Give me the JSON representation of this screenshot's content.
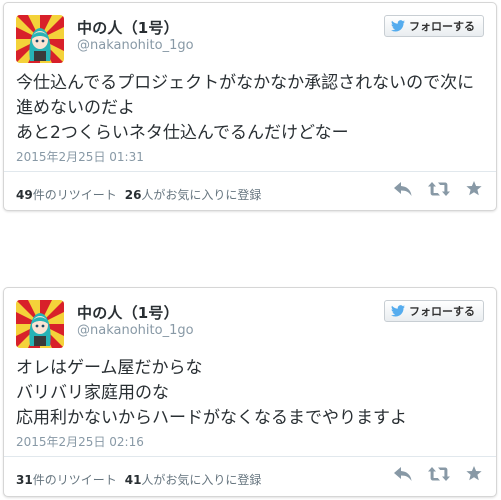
{
  "tweets": [
    {
      "name": "中の人（1号）",
      "handle": "@nakanohito_1go",
      "follow_label": "フォローする",
      "text": "今仕込んでるプロジェクトがなかなか承認されないので次に\n進めないのだよ\nあと2つくらいネタ仕込んでるんだけどなー",
      "timestamp": "2015年2月25日  01:31",
      "retweet_count": "49",
      "retweet_suffix": "件のリツイート",
      "favorite_count": "26",
      "favorite_suffix": "人がお気に入りに登録"
    },
    {
      "name": "中の人（1号）",
      "handle": "@nakanohito_1go",
      "follow_label": "フォローする",
      "text": "オレはゲーム屋だからな\nバリバリ家庭用のな\n応用利かないからハードがなくなるまでやりますよ",
      "timestamp": "2015年2月25日  02:16",
      "retweet_count": "31",
      "retweet_suffix": "件のリツイート",
      "favorite_count": "41",
      "favorite_suffix": "人がお気に入りに登録"
    }
  ],
  "colors": {
    "brand_blue": "#55acee",
    "text_primary": "#292f33",
    "text_secondary": "#8899a6",
    "icon_gray": "#8899a6",
    "avatar_red": "#d8202a",
    "avatar_yellow": "#f4d23a"
  },
  "icons": [
    "twitter-bird-icon",
    "reply-icon",
    "retweet-icon",
    "favorite-star-icon"
  ]
}
